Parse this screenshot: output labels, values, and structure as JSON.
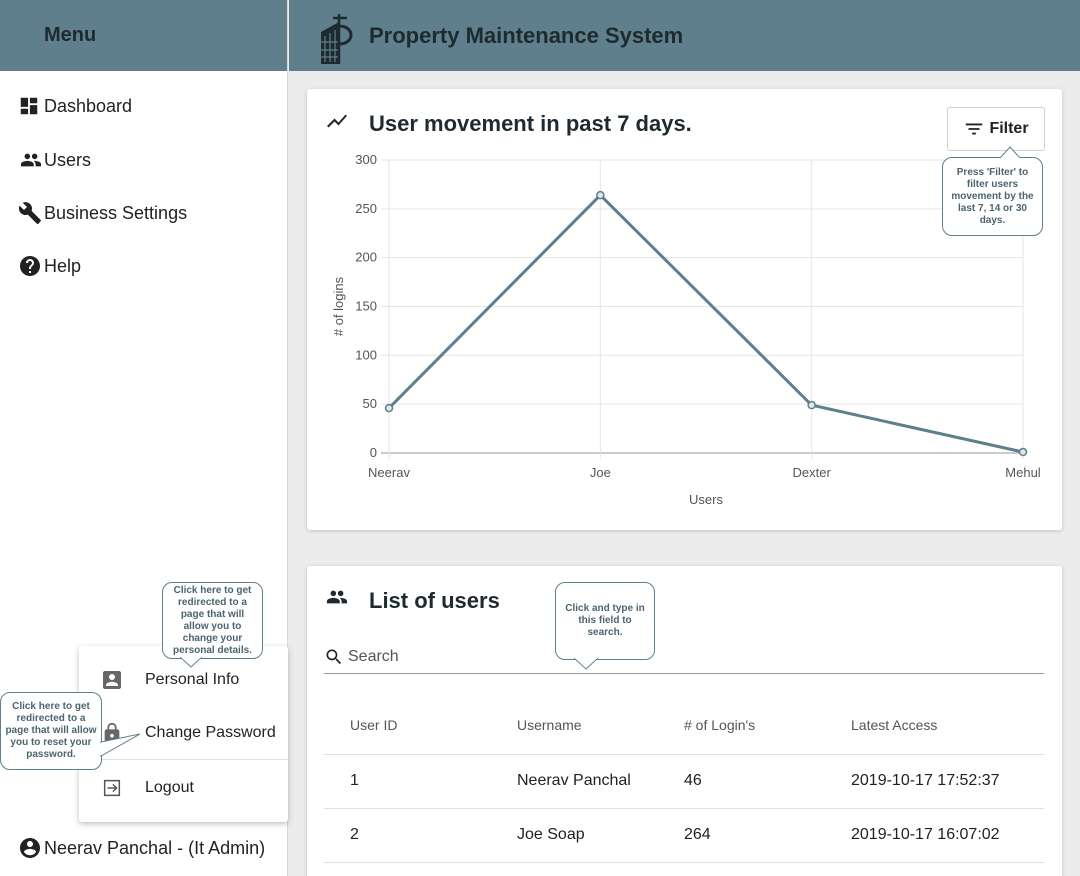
{
  "sidebar": {
    "title": "Menu",
    "items": [
      {
        "label": "Dashboard",
        "icon": "dashboard-icon"
      },
      {
        "label": "Users",
        "icon": "users-icon"
      },
      {
        "label": "Business Settings",
        "icon": "wrench-icon"
      },
      {
        "label": "Help",
        "icon": "help-icon"
      }
    ],
    "current_user": "Neerav Panchal - (It Admin)"
  },
  "header": {
    "title": "Property Maintenance System",
    "logo": "building-logo"
  },
  "chart_card": {
    "title": "User movement in past 7 days.",
    "filter_label": "Filter",
    "filter_tooltip": "Press 'Filter' to filter users movement by the last 7, 14 or 30 days."
  },
  "chart_data": {
    "type": "line",
    "categories": [
      "Neerav",
      "Joe",
      "Dexter",
      "Mehul"
    ],
    "values": [
      46,
      264,
      49,
      1
    ],
    "xlabel": "Users",
    "ylabel": "# of logins",
    "ylim": [
      0,
      300
    ],
    "yticks": [
      0,
      50,
      100,
      150,
      200,
      250,
      300
    ],
    "grid": true,
    "color": "#5f7f8d"
  },
  "users_card": {
    "title": "List of users",
    "search_placeholder": "Search",
    "search_tooltip": "Click and type in this field to search.",
    "columns": [
      "User ID",
      "Username",
      "# of Login's",
      "Latest Access"
    ],
    "rows": [
      [
        "1",
        "Neerav Panchal",
        "46",
        "2019-10-17 17:52:37"
      ],
      [
        "2",
        "Joe Soap",
        "264",
        "2019-10-17 16:07:02"
      ]
    ]
  },
  "user_menu": {
    "items": [
      {
        "label": "Personal Info",
        "icon": "account-box-icon"
      },
      {
        "label": "Change Password",
        "icon": "lock-icon"
      },
      {
        "label": "Logout",
        "icon": "logout-icon"
      }
    ],
    "personal_tooltip": "Click here to get redirected to a page that will allow you to change your personal details.",
    "password_tooltip": "Click here to get redirected to a page that will allow you to reset your password."
  },
  "colors": {
    "header_bg": "#5f7f8d",
    "page_bg": "#ececec"
  }
}
